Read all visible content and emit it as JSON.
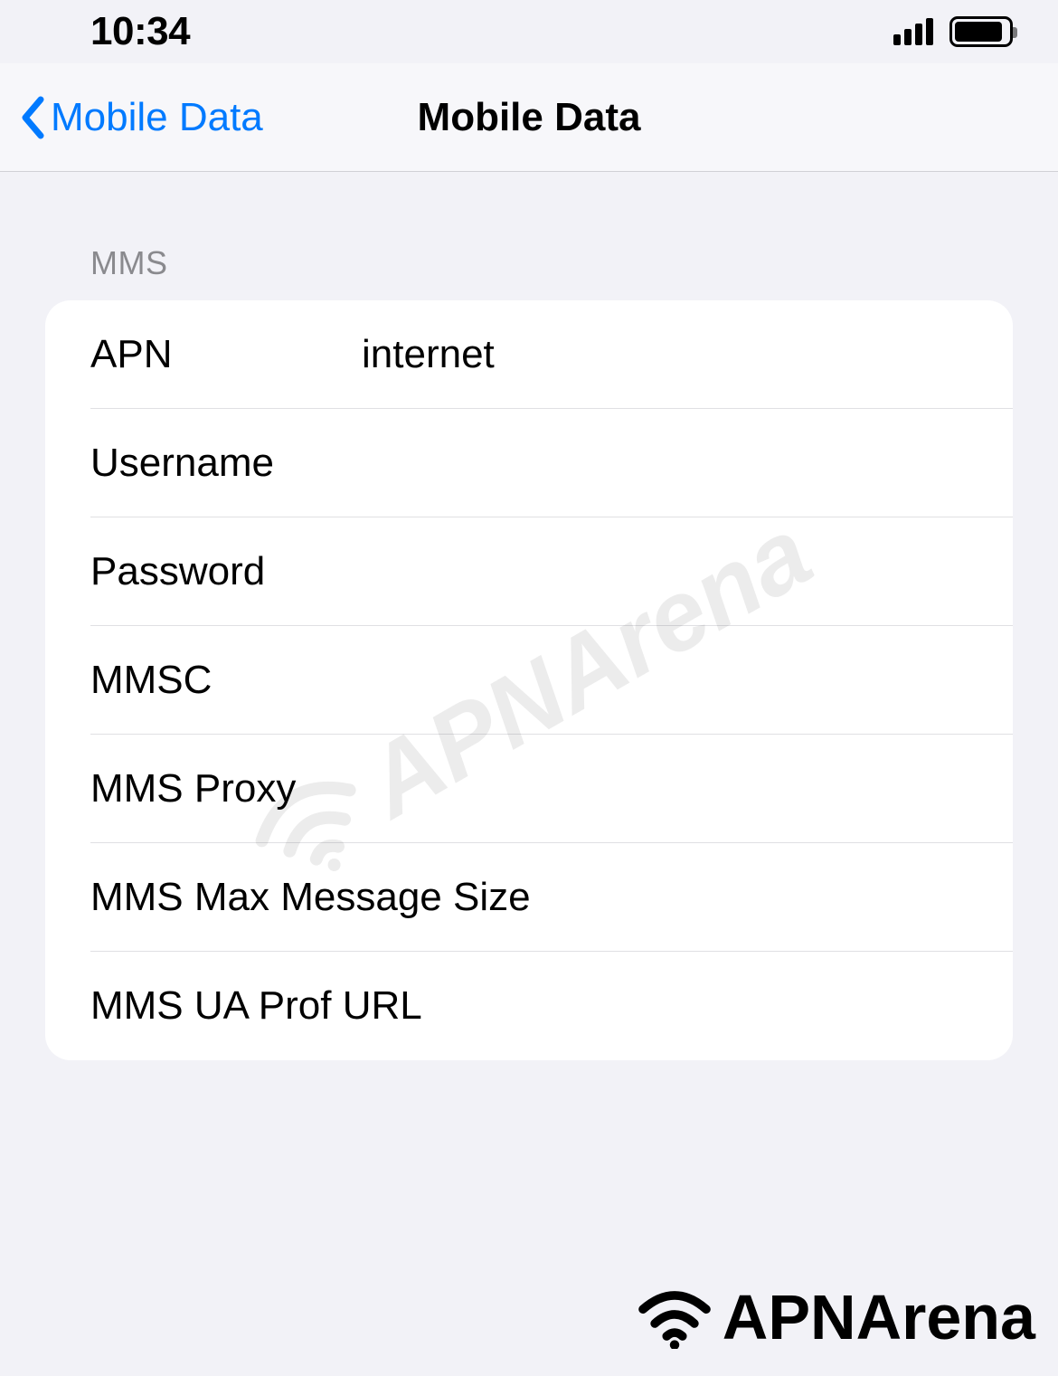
{
  "status": {
    "time": "10:34"
  },
  "nav": {
    "back_label": "Mobile Data",
    "title": "Mobile Data"
  },
  "section": {
    "header": "MMS",
    "rows": [
      {
        "label": "APN",
        "value": "internet"
      },
      {
        "label": "Username",
        "value": ""
      },
      {
        "label": "Password",
        "value": ""
      },
      {
        "label": "MMSC",
        "value": ""
      },
      {
        "label": "MMS Proxy",
        "value": ""
      },
      {
        "label": "MMS Max Message Size",
        "value": ""
      },
      {
        "label": "MMS UA Prof URL",
        "value": ""
      }
    ]
  },
  "watermark": "APNArena",
  "footer": "APNArena"
}
